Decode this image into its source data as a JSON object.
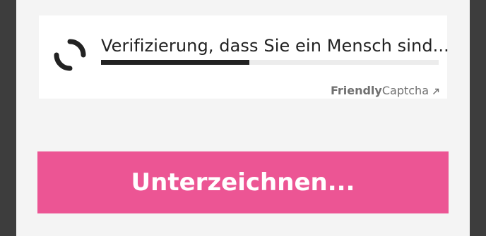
{
  "captcha": {
    "status_text": "Verifizierung, dass Sie ein Mensch sind...",
    "progress": 0.44,
    "brand_bold": "Friendly",
    "brand_regular": "Captcha",
    "spinner_icon": "loading-spinner-icon",
    "link_icon": "external-link-icon"
  },
  "form": {
    "submit_label": "Unterzeichnen..."
  },
  "colors": {
    "accent": "#ec5594",
    "progress_fill": "#222222",
    "progress_track": "#ececec",
    "panel_bg": "#f4f4f4",
    "outer_bg": "#3d3d3d"
  }
}
